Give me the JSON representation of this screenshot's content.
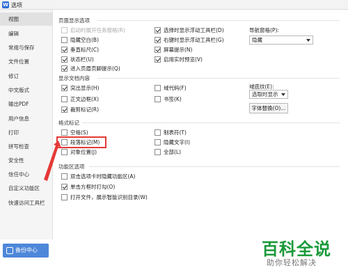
{
  "window": {
    "title": "选项",
    "icon_text": "W"
  },
  "sidebar": {
    "items": [
      {
        "label": "视图",
        "active": true
      },
      {
        "label": "编辑"
      },
      {
        "label": "常规与保存"
      },
      {
        "label": "文件位置"
      },
      {
        "label": "修订"
      },
      {
        "label": "中文版式"
      },
      {
        "label": "输出PDF"
      },
      {
        "label": "用户信息"
      },
      {
        "label": "打印"
      },
      {
        "label": "拼写检查"
      },
      {
        "label": "安全性"
      },
      {
        "label": "信任中心"
      },
      {
        "label": "自定义功能区"
      },
      {
        "label": "快速访问工具栏"
      }
    ],
    "backup_button": "备份中心"
  },
  "sections": {
    "page_display": {
      "title": "页面显示选项",
      "options": [
        {
          "label": "启动时展开任务窗格(R)",
          "checked": false,
          "disabled": true
        },
        {
          "label": "隐藏空白(B)",
          "checked": false
        },
        {
          "label": "垂直标尺(C)",
          "checked": true
        },
        {
          "label": "状态栏(U)",
          "checked": true
        },
        {
          "label": "进入页眉页脚提示(Q)",
          "checked": true
        },
        {
          "label": "选择时显示浮动工具栏(D)",
          "checked": true
        },
        {
          "label": "右键时显示浮动工具栏(G)",
          "checked": true
        },
        {
          "label": "屏幕提示(N)",
          "checked": true
        },
        {
          "label": "启用实时预览(V)",
          "checked": true
        }
      ],
      "nav_pane_label": "导航窗格(P):",
      "nav_pane_value": "隐藏"
    },
    "doc_content": {
      "title": "显示文档内容",
      "options": [
        {
          "label": "突出显示(H)",
          "checked": true
        },
        {
          "label": "正文边框(X)",
          "checked": false
        },
        {
          "label": "裁剪标记(R)",
          "checked": true
        },
        {
          "label": "域代码(F)",
          "checked": false
        },
        {
          "label": "书签(K)",
          "checked": false
        }
      ],
      "field_shading_label": "域底纹(E):",
      "field_shading_value": "选取时显示",
      "font_replace_button": "字体替换(O)..."
    },
    "format_marks": {
      "title": "格式标记",
      "options": [
        {
          "label": "空格(S)",
          "checked": false
        },
        {
          "label": "段落标记(M)",
          "checked": false
        },
        {
          "label": "对象位置(J)",
          "checked": false
        },
        {
          "label": "制表符(T)",
          "checked": false
        },
        {
          "label": "隐藏文字(I)",
          "checked": false
        },
        {
          "label": "全部(L)",
          "checked": false
        }
      ]
    },
    "ribbon": {
      "title": "功能区选项",
      "options": [
        {
          "label": "双击选项卡时隐藏功能区(A)",
          "checked": false
        },
        {
          "label": "单击方框时打勾(O)",
          "checked": true
        },
        {
          "label": "打开文件，展示智能识别目录(W)",
          "checked": false
        }
      ]
    }
  },
  "watermark": {
    "title": "百科全说",
    "subtitle": "助你轻松解决"
  },
  "colors": {
    "accent": "#4d87d9",
    "highlight": "#e53935",
    "watermark": "#1a9a3a"
  }
}
